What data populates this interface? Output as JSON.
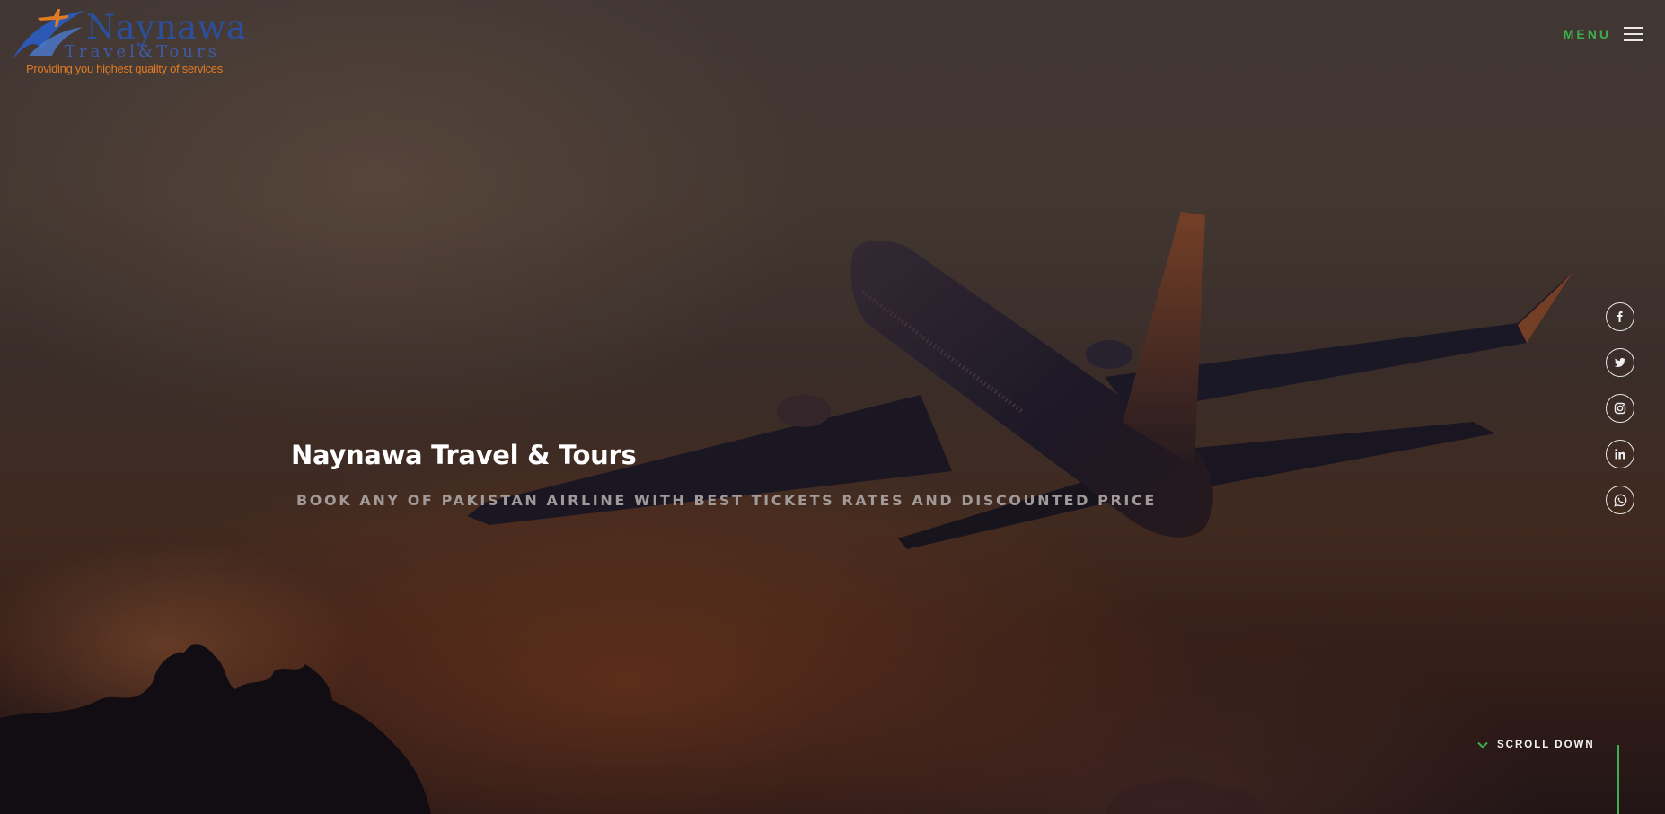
{
  "logo": {
    "name": "Naynawa",
    "subtitle": "Travel&Tours",
    "tagline": "Providing you highest quality of services"
  },
  "menu": {
    "label": "MENU"
  },
  "hero": {
    "title": "Naynawa Travel & Tours",
    "subtitle": "BOOK ANY OF PAKISTAN AIRLINE WITH BEST TICKETS RATES AND DISCOUNTED PRICE"
  },
  "social": [
    {
      "icon": "facebook-icon"
    },
    {
      "icon": "twitter-icon"
    },
    {
      "icon": "instagram-icon"
    },
    {
      "icon": "linkedin-icon"
    },
    {
      "icon": "whatsapp-icon"
    }
  ],
  "scroll": {
    "label": "SCROLL DOWN"
  },
  "colors": {
    "accent": "#3fae4e",
    "logo_blue": "#2c4f9c",
    "logo_orange": "#e07b25"
  }
}
